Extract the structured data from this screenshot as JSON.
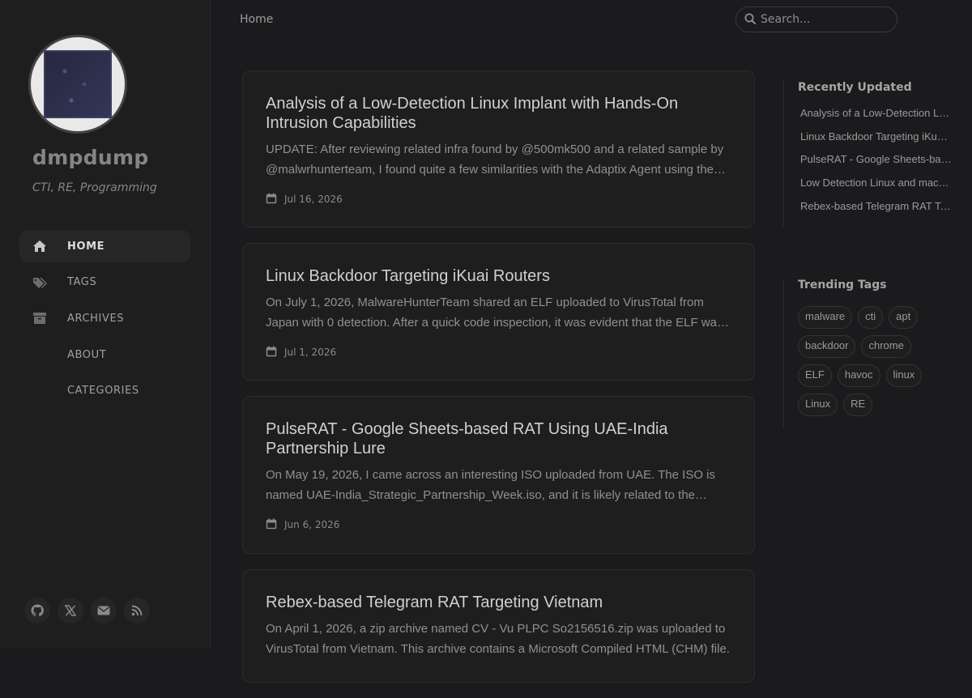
{
  "site": {
    "title": "dmpdump",
    "subtitle": "CTI, RE, Programming"
  },
  "nav": [
    {
      "label": "HOME",
      "icon": "home-icon",
      "active": true
    },
    {
      "label": "TAGS",
      "icon": "tags-icon"
    },
    {
      "label": "ARCHIVES",
      "icon": "archive-icon"
    },
    {
      "label": "ABOUT",
      "icon": "info-icon"
    },
    {
      "label": "CATEGORIES",
      "icon": "stream-icon"
    }
  ],
  "social": [
    "github-icon",
    "x-twitter-icon",
    "envelope-icon",
    "rss-icon"
  ],
  "topbar": {
    "breadcrumb": "Home",
    "search_placeholder": "Search..."
  },
  "posts": [
    {
      "title": "Analysis of a Low-Detection Linux Implant with Hands-On Intrusion Capabilities",
      "excerpt": "UPDATE: After reviewing related infra found by @500mk500 and a related sample by @malwrhunterteam, I found quite a few similarities with the Adaptix Agent using the same XOR key and similar configuration.",
      "date": "Jul 16, 2026"
    },
    {
      "title": "Linux Backdoor Targeting iKuai Routers",
      "excerpt": "On July 1, 2026, MalwareHunterTeam shared an ELF uploaded to VirusTotal from Japan with 0 detection. After a quick code inspection, it was evident that the ELF was a backdoor targeting iKuai routers.",
      "date": "Jul 1, 2026"
    },
    {
      "title": "PulseRAT - Google Sheets-based RAT Using UAE-India Partnership Lure",
      "excerpt": "On May 19, 2026, I came across an interesting ISO uploaded from UAE. The ISO is named UAE-India_Strategic_Partnership_Week.iso, and it is likely related to the upcoming strategic week.",
      "date": "Jun 6, 2026"
    },
    {
      "title": "Rebex-based Telegram RAT Targeting Vietnam",
      "excerpt": "On April 1, 2026, a zip archive named CV - Vu PLPC So2156516.zip was uploaded to VirusTotal from Vietnam. This archive contains a Microsoft Compiled HTML (CHM) file.",
      "date": ""
    }
  ],
  "panel": {
    "recent_heading": "Recently Updated",
    "recent": [
      "Analysis of a Low-Detection Linux Implant with Hands-On Intrusion Capabilities",
      "Linux Backdoor Targeting iKuai Routers",
      "PulseRAT - Google Sheets-based RAT Using UAE-India Partnership Lure",
      "Low Detection Linux and macOS Havoc Agent",
      "Rebex-based Telegram RAT Targeting Vietnam"
    ],
    "tags_heading": "Trending Tags",
    "tags": [
      "malware",
      "cti",
      "apt",
      "backdoor",
      "chrome",
      "ELF",
      "havoc",
      "linux",
      "Linux",
      "RE"
    ]
  }
}
